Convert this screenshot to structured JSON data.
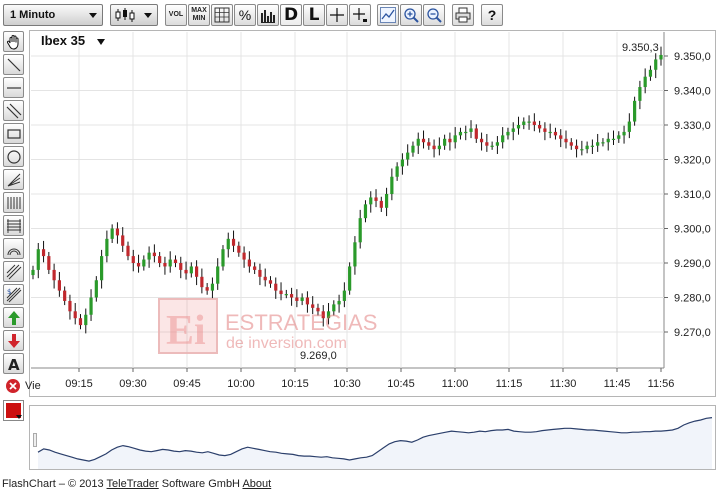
{
  "toolbar": {
    "interval_select": "1 Minuto",
    "vol_label": "VOL",
    "maxmin_line1": "MAX",
    "maxmin_line2": "MIN",
    "percent_label": "%",
    "d_label": "D",
    "l_label": "L",
    "help_label": "?"
  },
  "chart": {
    "instrument": "Ibex 35",
    "last_price_label": "9.350,3",
    "low_price_label": "9.269,0",
    "x_first_label": "Vie",
    "watermark_line1": "ESTRATEGIAS",
    "watermark_line2": "de inversion.com",
    "up_color": "#2a9a2a",
    "down_color": "#c0282d"
  },
  "chart_data": {
    "type": "candlestick",
    "x_ticks": [
      "09:15",
      "09:30",
      "09:45",
      "10:00",
      "10:15",
      "10:30",
      "10:45",
      "11:00",
      "11:15",
      "11:30",
      "11:45",
      "11:56"
    ],
    "y_ticks": [
      "9.270,0",
      "9.280,0",
      "9.290,0",
      "9.300,0",
      "9.310,0",
      "9.320,0",
      "9.330,0",
      "9.340,0",
      "9.350,0"
    ],
    "ylim": [
      9265,
      9355
    ],
    "close_series": [
      9288,
      9294,
      9292,
      9288,
      9285,
      9282,
      9279,
      9276,
      9274,
      9272,
      9275,
      9280,
      9285,
      9292,
      9297,
      9300,
      9298,
      9295,
      9292,
      9290,
      9289,
      9291,
      9293,
      9292,
      9290,
      9289,
      9291,
      9290,
      9288,
      9287,
      9289,
      9286,
      9283,
      9282,
      9284,
      9289,
      9294,
      9297,
      9295,
      9293,
      9291,
      9289,
      9288,
      9286,
      9285,
      9284,
      9282,
      9281,
      9281,
      9280,
      9279,
      9280,
      9278,
      9277,
      9276,
      9274,
      9276,
      9278,
      9279,
      9282,
      9289,
      9296,
      9303,
      9307,
      9309,
      9308,
      9306,
      9310,
      9315,
      9318,
      9320,
      9322,
      9324,
      9326,
      9325,
      9324,
      9323,
      9324,
      9326,
      9325,
      9327,
      9328,
      9328,
      9329,
      9326,
      9325,
      9324,
      9324,
      9325,
      9327,
      9328,
      9329,
      9330,
      9331,
      9331,
      9330,
      9329,
      9328,
      9328,
      9327,
      9326,
      9325,
      9324,
      9323,
      9323,
      9324,
      9324,
      9325,
      9325,
      9326,
      9326,
      9327,
      9328,
      9331,
      9337,
      9341,
      9344,
      9346,
      9349,
      9350.3
    ]
  },
  "footer": {
    "prefix": "FlashChart – © 2013 ",
    "company": "TeleTrader",
    "suffix": " Software GmbH ",
    "about": "About"
  }
}
